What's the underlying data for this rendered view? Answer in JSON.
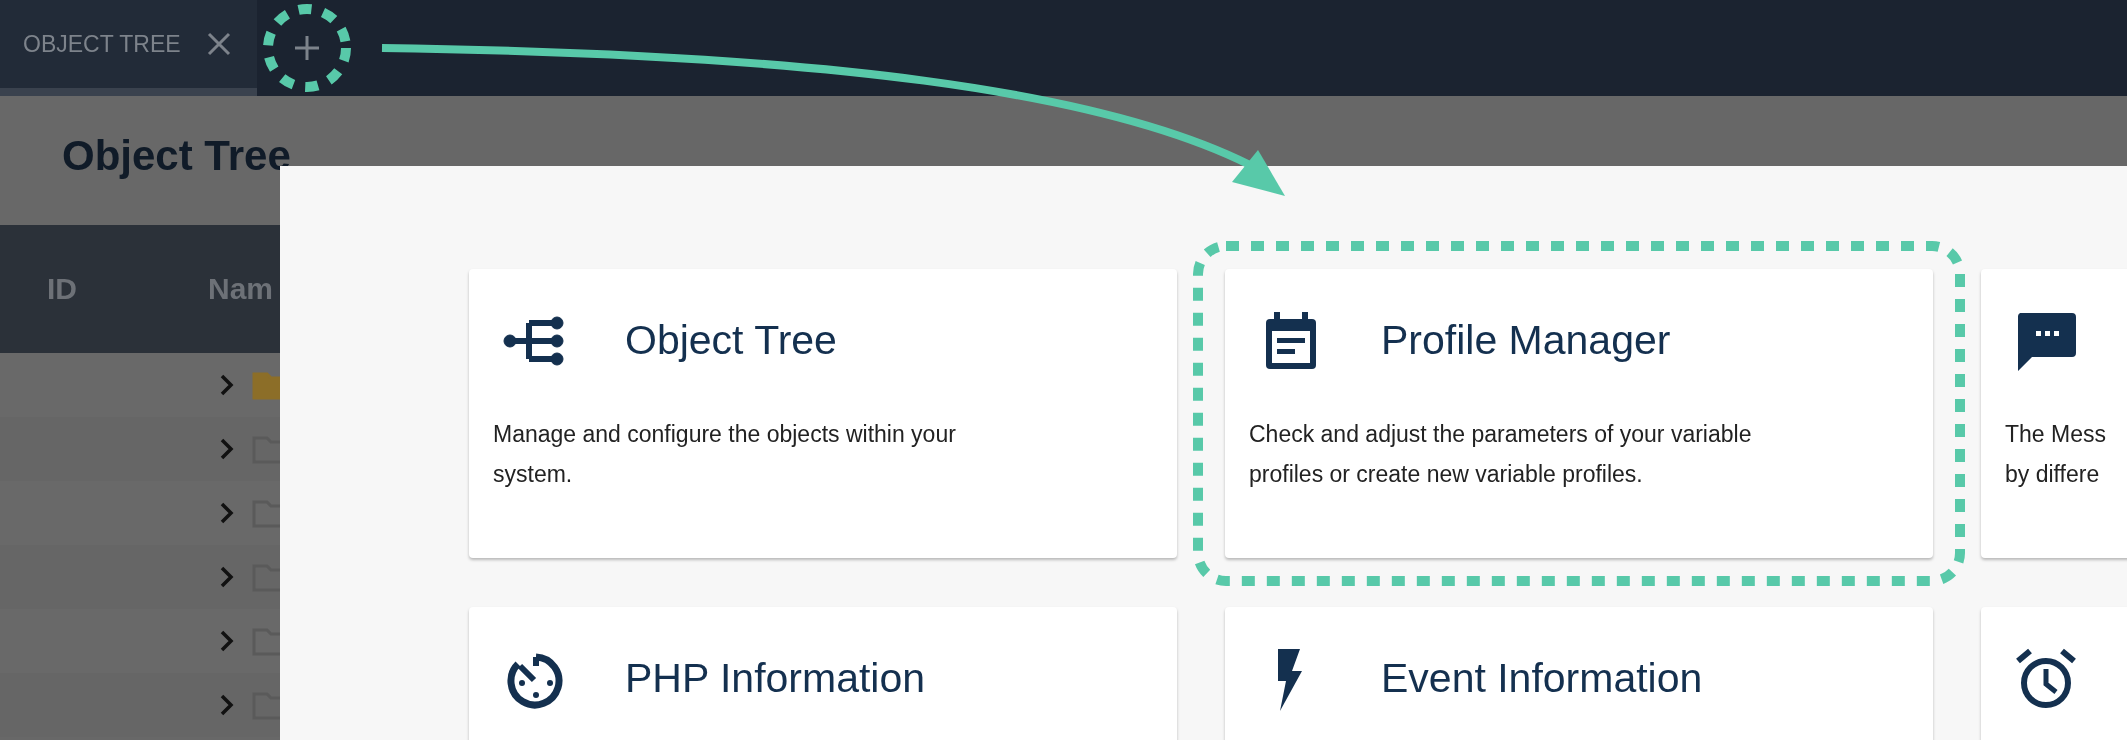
{
  "tabs": [
    {
      "label": "OBJECT TREE",
      "selected": true
    }
  ],
  "add_tab_button": {
    "highlighted": true
  },
  "page": {
    "title": "Object Tree"
  },
  "table": {
    "columns": [
      "ID",
      "Nam"
    ],
    "rows": [
      {
        "expanded": false,
        "color": "#8c6e28"
      },
      {
        "expanded": false,
        "color": "#5a5a5a"
      },
      {
        "expanded": false,
        "color": "#5a5a5a"
      },
      {
        "expanded": false,
        "color": "#5a5a5a"
      },
      {
        "expanded": false,
        "color": "#5a5a5a"
      },
      {
        "expanded": false,
        "color": "#5a5a5a"
      }
    ]
  },
  "cards": [
    {
      "title": "Object Tree",
      "description": [
        "Manage and configure the objects within your",
        "system."
      ],
      "highlighted": false
    },
    {
      "title": "Profile Manager",
      "description": [
        "Check and adjust the parameters of your variable",
        "profiles or create new variable profiles."
      ],
      "highlighted": true
    },
    {
      "description": [
        "The Mess",
        "by differe"
      ],
      "highlighted": false
    },
    {
      "title": "PHP Information",
      "highlighted": false
    },
    {
      "title": "Event Information",
      "highlighted": false
    },
    {
      "highlighted": false
    }
  ]
}
